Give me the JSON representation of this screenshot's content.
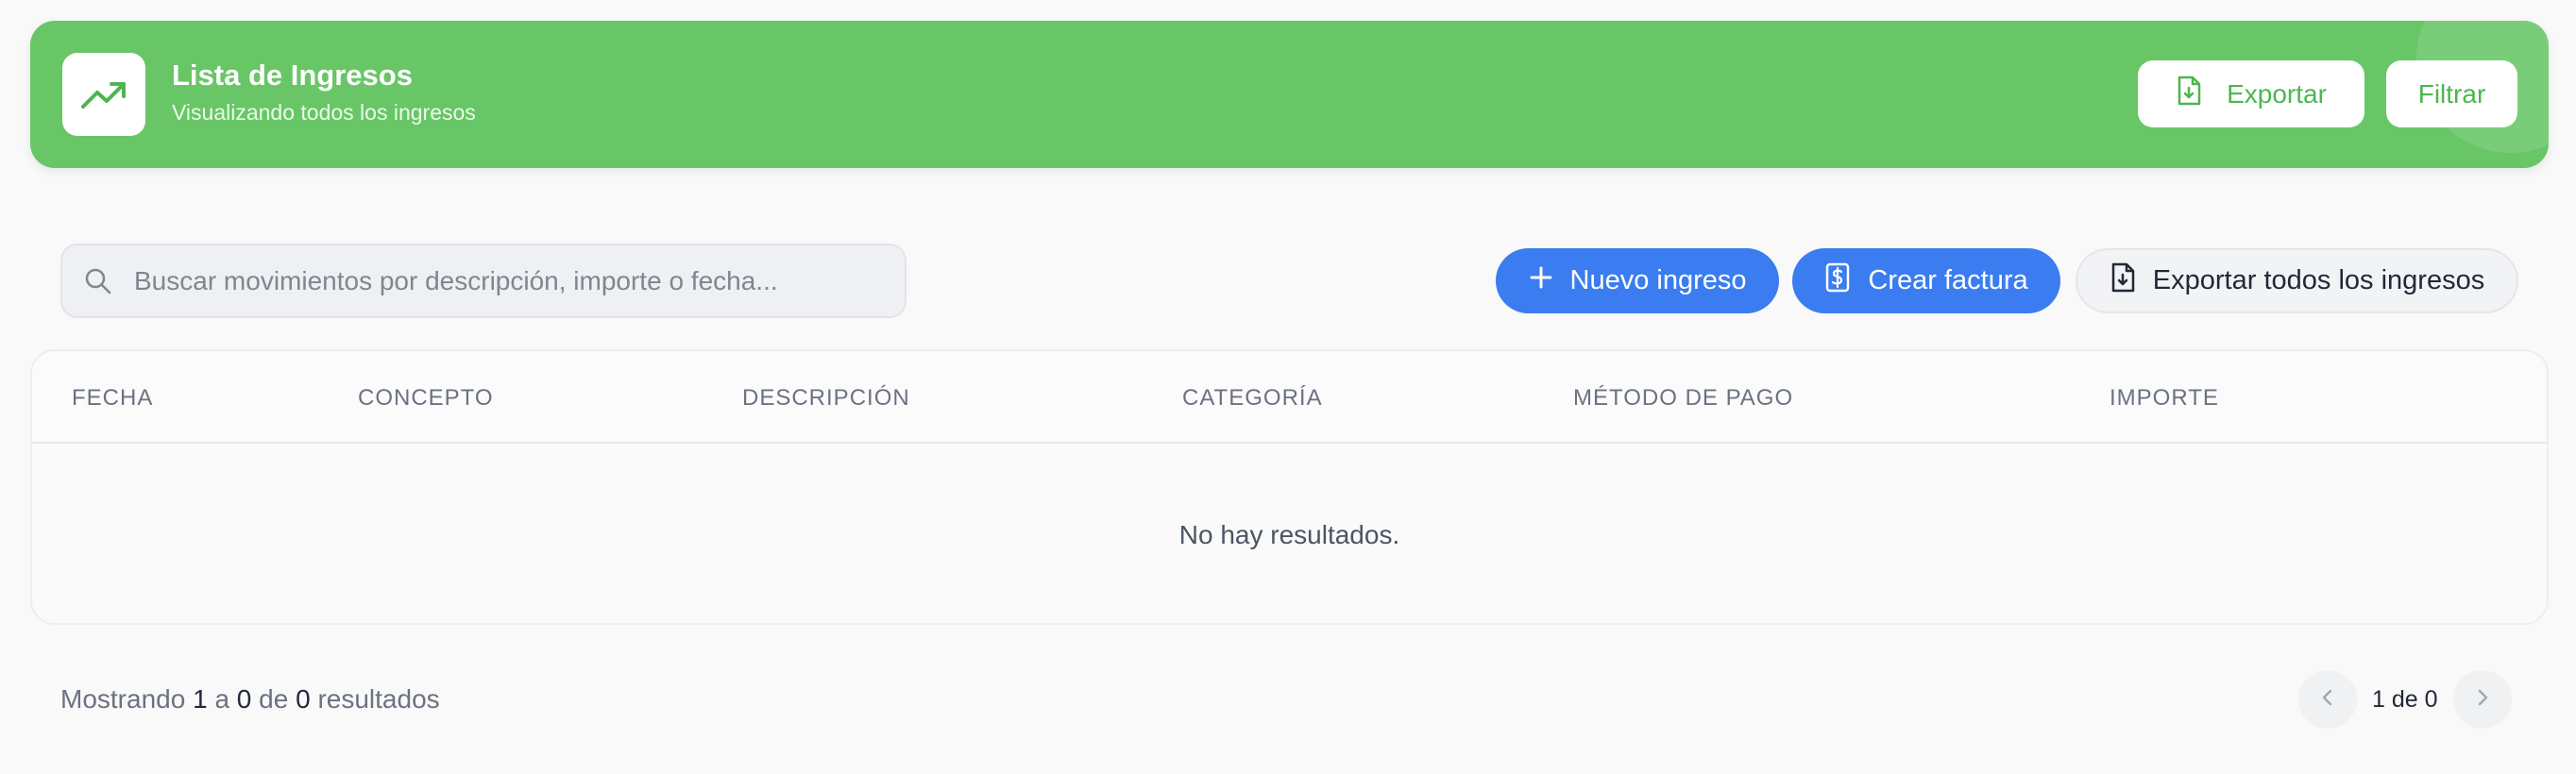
{
  "header": {
    "title": "Lista de Ingresos",
    "subtitle": "Visualizando todos los ingresos",
    "icon": "trending-up-icon",
    "export_label": "Exportar",
    "filter_label": "Filtrar",
    "background": "#68c666"
  },
  "toolbar": {
    "search_placeholder": "Buscar movimientos por descripción, importe o fecha...",
    "new_income_label": "Nuevo ingreso",
    "create_invoice_label": "Crear factura",
    "export_all_label": "Exportar todos los ingresos",
    "accent": "#3b7df0"
  },
  "table": {
    "columns": [
      "FECHA",
      "CONCEPTO",
      "DESCRIPCIÓN",
      "CATEGORÍA",
      "MÉTODO DE PAGO",
      "IMPORTE"
    ],
    "rows": [],
    "empty_message": "No hay resultados."
  },
  "footer": {
    "showing_prefix": "Mostrando",
    "from": "1",
    "a": "a",
    "to": "0",
    "de": "de",
    "total": "0",
    "results": "resultados",
    "page_label": "1 de 0"
  }
}
